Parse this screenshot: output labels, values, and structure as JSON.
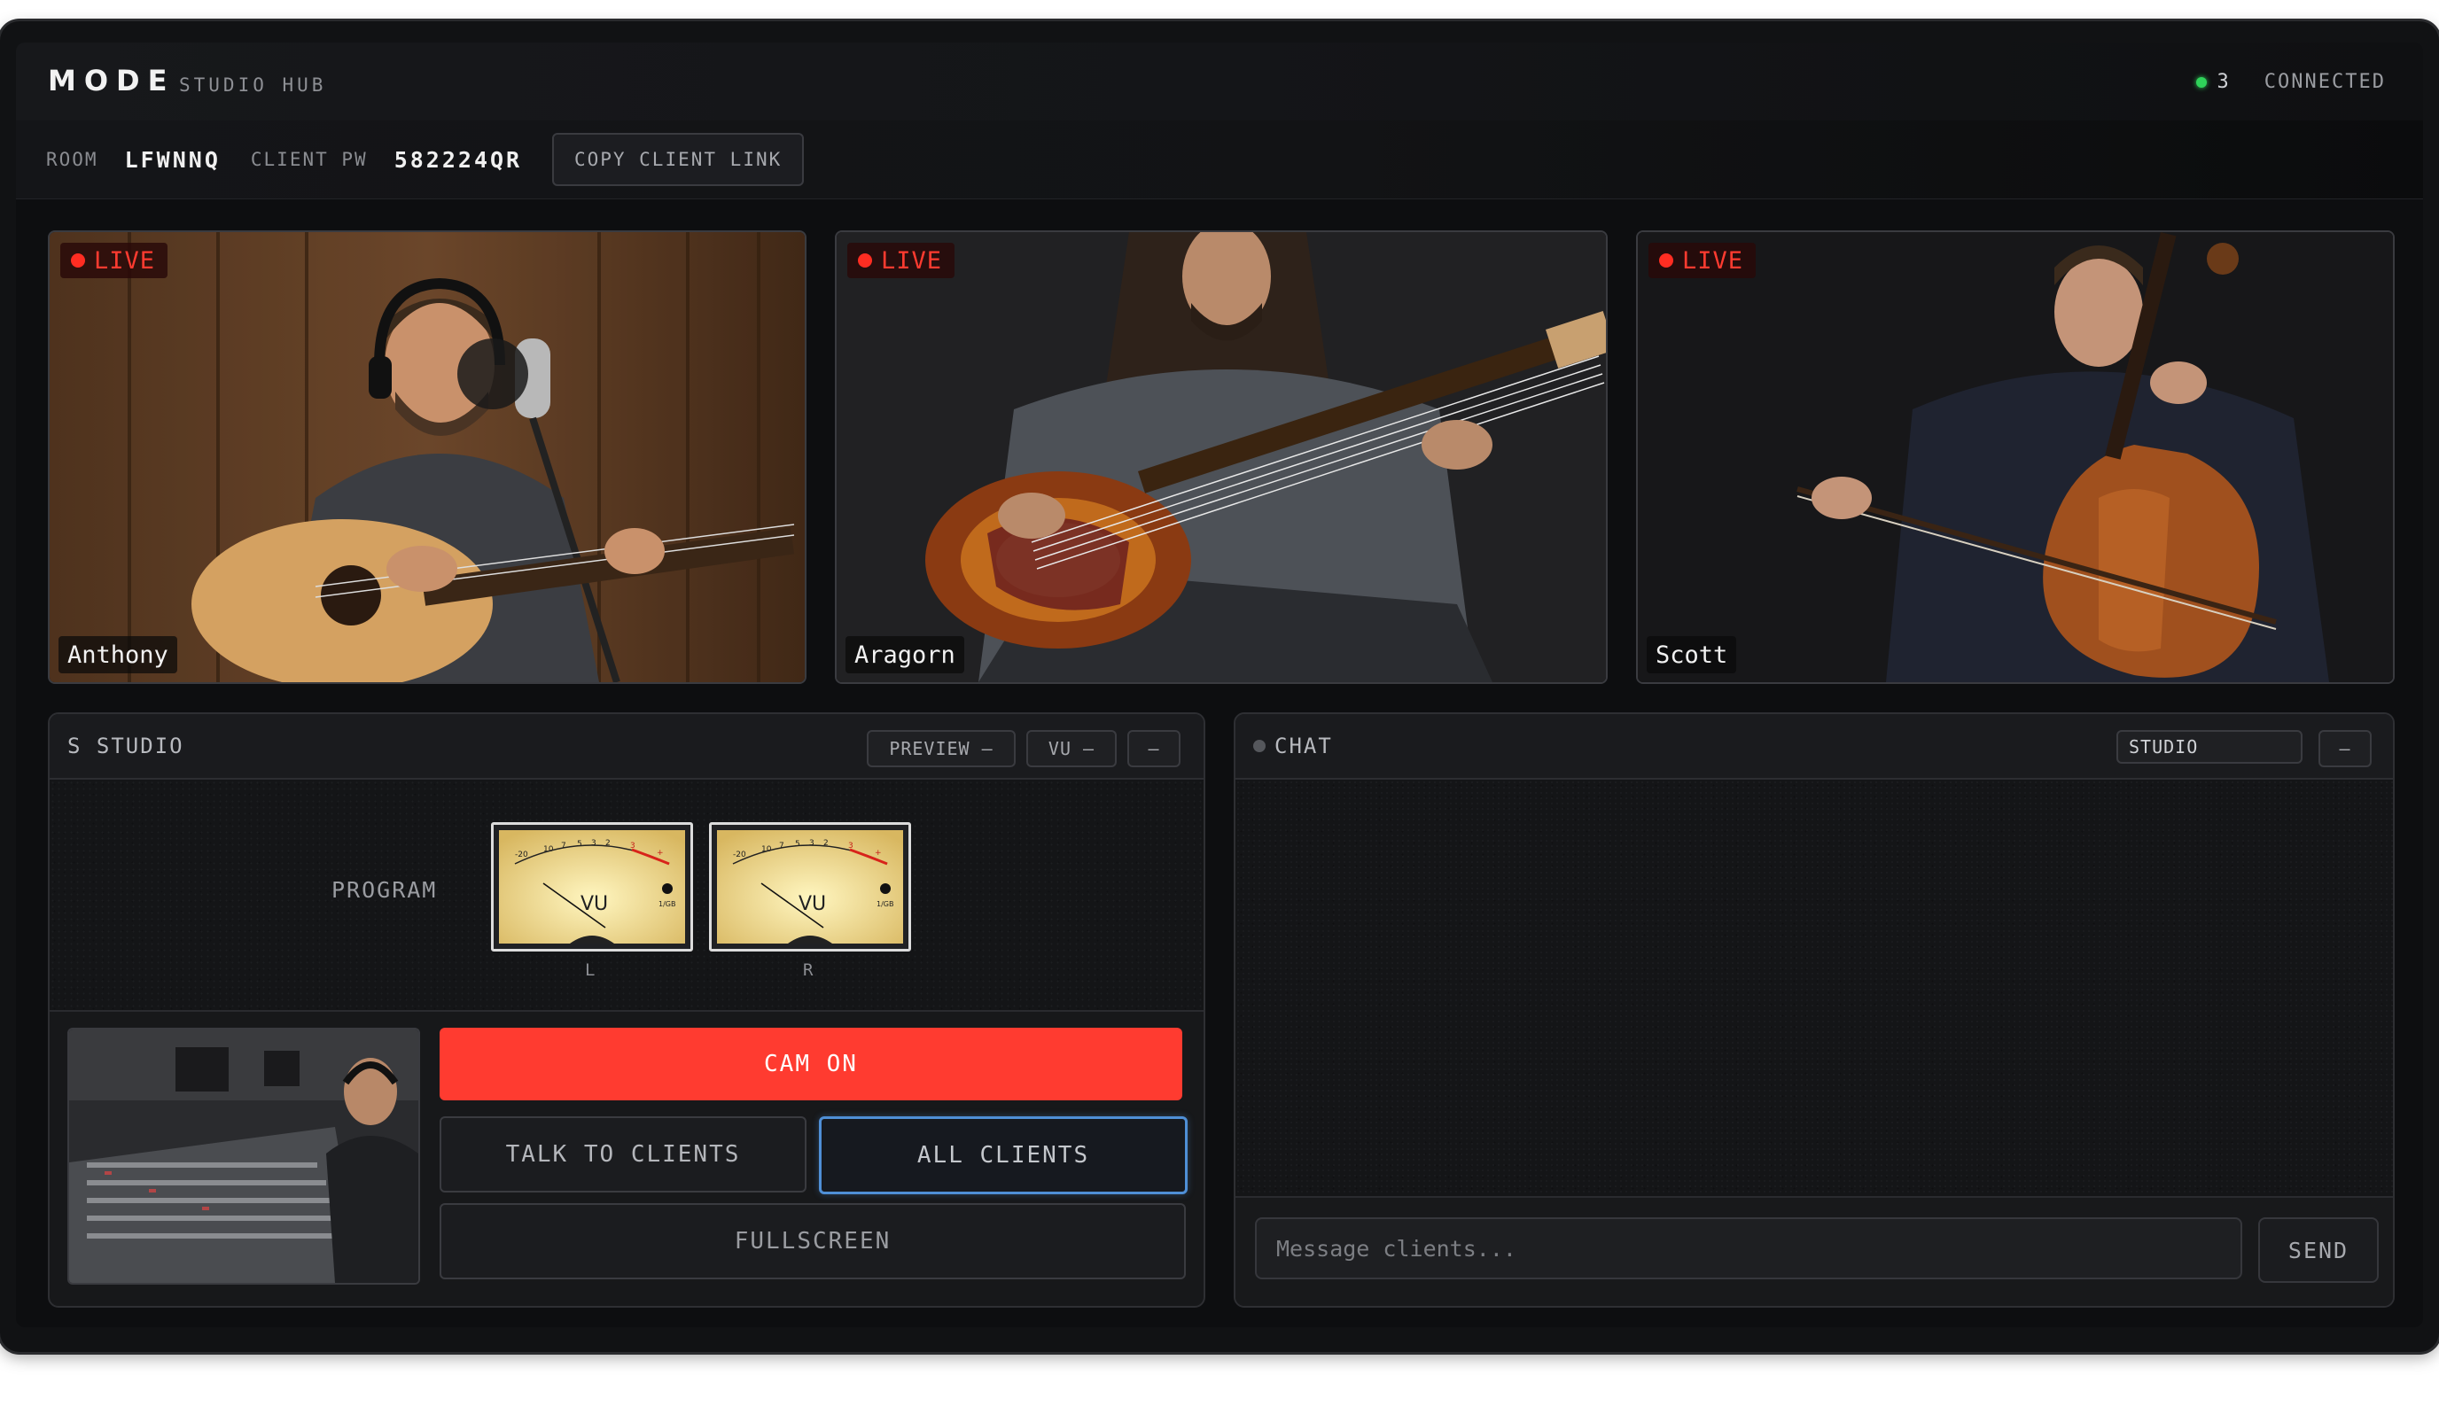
{
  "app": {
    "brand": "MODE",
    "subtitle": "STUDIO HUB"
  },
  "connection": {
    "count": "3",
    "status": "CONNECTED",
    "dot_color": "#2fd35a",
    "icon": "status-dot-icon"
  },
  "room": {
    "room_label": "ROOM",
    "room_code": "LFWNNQ",
    "pw_label": "CLIENT PW",
    "pw_value": "582224QR",
    "copy_label": "COPY CLIENT LINK"
  },
  "tiles": [
    {
      "live": "LIVE",
      "name": "Anthony"
    },
    {
      "live": "LIVE",
      "name": "Aragorn"
    },
    {
      "live": "LIVE",
      "name": "Scott"
    }
  ],
  "studio": {
    "title": "STUDIO",
    "title_prefix": "S",
    "chips": {
      "preview": "PREVIEW –",
      "vu": "VU –",
      "collapse": "–"
    },
    "program_label": "PROGRAM",
    "meters": [
      {
        "face": "VU",
        "channel": "L",
        "scale": [
          "-20",
          "10",
          "7",
          "5",
          "3",
          "2",
          "1",
          "0",
          "1",
          "2",
          "3",
          "+"
        ],
        "unit": "1/GB"
      },
      {
        "face": "VU",
        "channel": "R",
        "scale": [
          "-20",
          "10",
          "7",
          "5",
          "3",
          "2",
          "1",
          "0",
          "1",
          "2",
          "3",
          "+"
        ],
        "unit": "1/GB"
      }
    ],
    "buttons": {
      "cam_on": "CAM ON",
      "talk": "TALK TO CLIENTS",
      "all_clients": "ALL CLIENTS",
      "fullscreen": "FULLSCREEN"
    }
  },
  "chat": {
    "title": "CHAT",
    "target": "STUDIO",
    "collapse": "–",
    "placeholder": "Message clients...",
    "send": "SEND"
  },
  "colors": {
    "accent_red": "#ff3b30",
    "focus_blue": "#4f8fd6",
    "live_red": "#ff2d22"
  }
}
